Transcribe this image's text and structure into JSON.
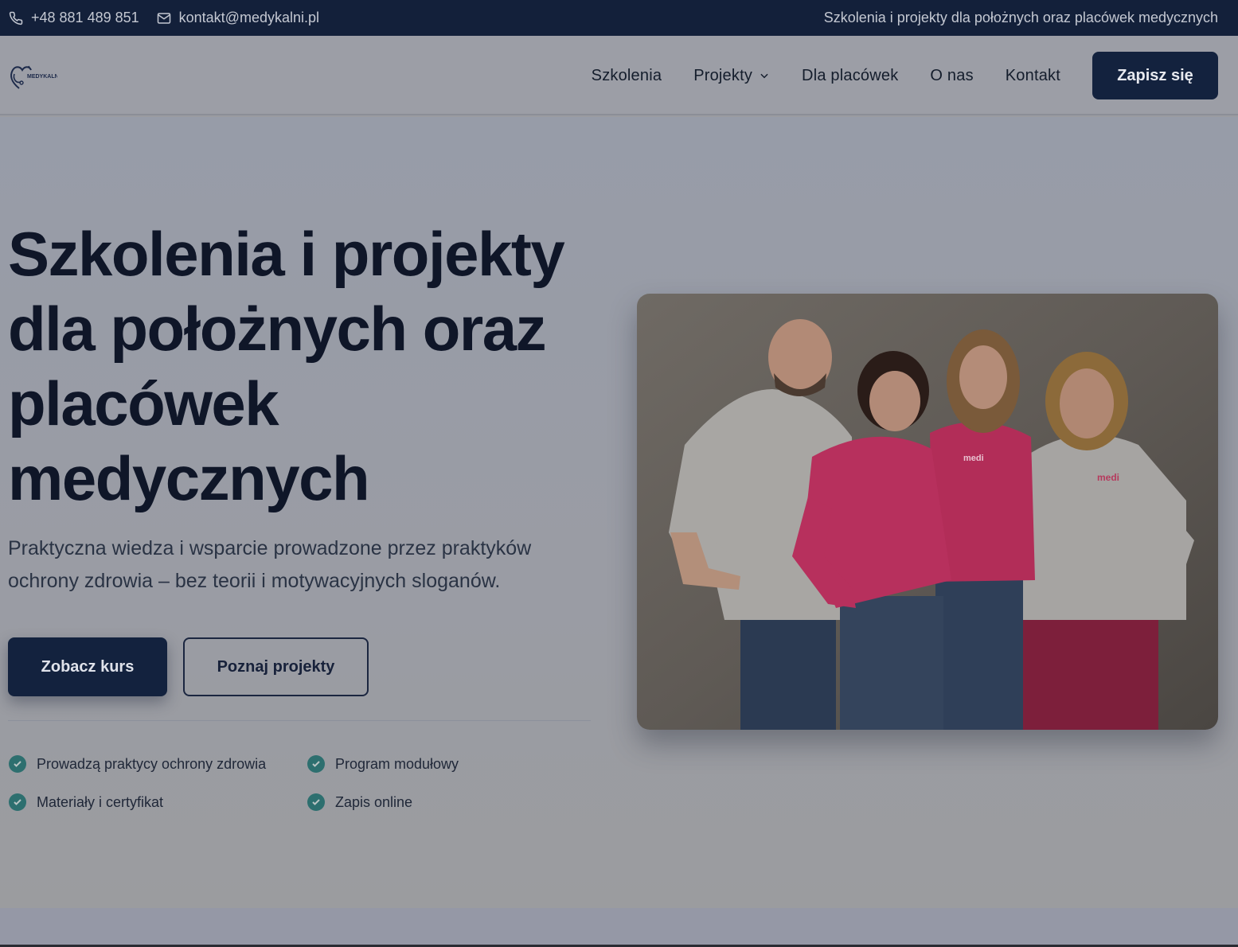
{
  "topbar": {
    "phone": "+48 881 489 851",
    "email": "kontakt@medykalni.pl",
    "tagline": "Szkolenia i projekty dla położnych oraz placówek medycznych"
  },
  "header": {
    "logo_text": "MEDYKALNI",
    "nav": {
      "szkolenia": "Szkolenia",
      "projekty": "Projekty",
      "placowki": "Dla placówek",
      "onas": "O nas",
      "kontakt": "Kontakt"
    },
    "cta": "Zapisz się"
  },
  "hero": {
    "title_lines": [
      "Szkolenia i projekty",
      "dla położnych oraz",
      "placówek",
      "medycznych"
    ],
    "lead_lines": [
      "Praktyczna wiedza i wsparcie prowadzone przez praktyków",
      "ochrony zdrowia – bez teorii i motywacyjnych sloganów."
    ],
    "primary_button": "Zobacz kurs",
    "secondary_button": "Poznaj projekty",
    "features": [
      "Prowadzą praktycy ochrony zdrowia",
      "Program modułowy",
      "Materiały i certyfikat",
      "Zapis online"
    ],
    "shirt_logo": "medi"
  },
  "colors": {
    "navy": "#13223e",
    "teal_check": "#2d6f6f",
    "pink_shirt": "#c2305f"
  },
  "icons": {
    "phone": "phone-icon",
    "email": "mail-icon",
    "dropdown": "chevron-down-icon",
    "check": "check-circle-icon"
  }
}
